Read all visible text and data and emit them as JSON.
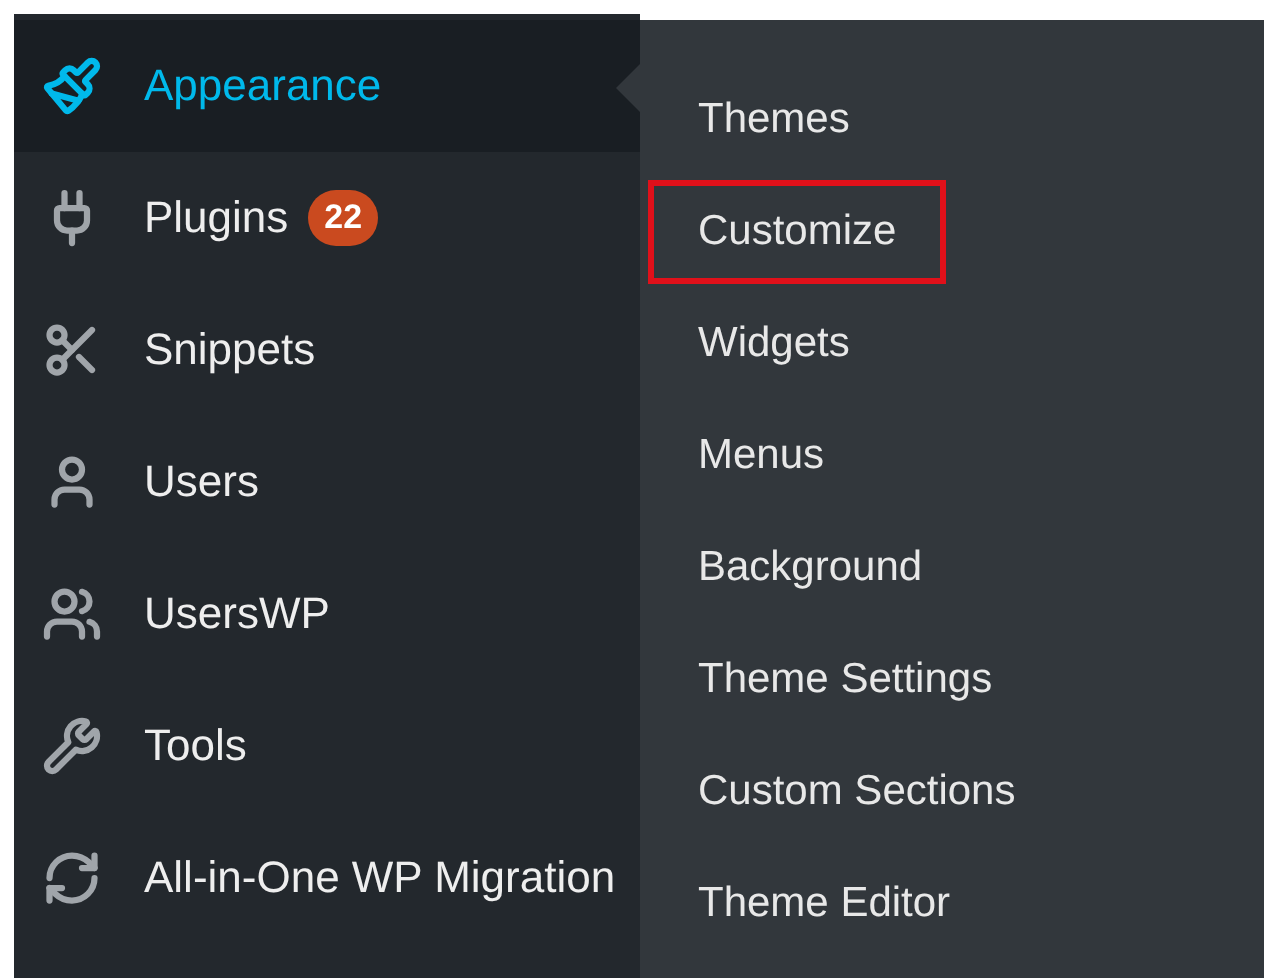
{
  "sidebar": {
    "items": [
      {
        "label": "Appearance",
        "selected": true
      },
      {
        "label": "Plugins",
        "selected": false,
        "badge": "22"
      },
      {
        "label": "Snippets",
        "selected": false
      },
      {
        "label": "Users",
        "selected": false
      },
      {
        "label": "UsersWP",
        "selected": false
      },
      {
        "label": "Tools",
        "selected": false
      },
      {
        "label": "All-in-One WP Migration",
        "selected": false
      }
    ]
  },
  "submenu": {
    "items": [
      {
        "label": "Themes",
        "highlighted": false
      },
      {
        "label": "Customize",
        "highlighted": true
      },
      {
        "label": "Widgets",
        "highlighted": false
      },
      {
        "label": "Menus",
        "highlighted": false
      },
      {
        "label": "Background",
        "highlighted": false
      },
      {
        "label": "Theme Settings",
        "highlighted": false
      },
      {
        "label": "Custom Sections",
        "highlighted": false
      },
      {
        "label": "Theme Editor",
        "highlighted": false
      }
    ]
  }
}
